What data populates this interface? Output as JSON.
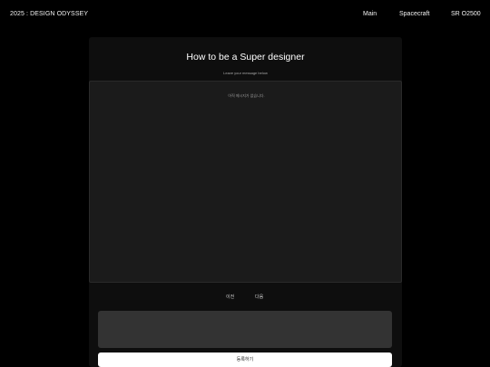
{
  "header": {
    "brand": "2025 : DESIGN ODYSSEY",
    "nav": {
      "main": "Main",
      "spacecraft": "Spacecraft",
      "sr": "SR O2500"
    }
  },
  "guestbook": {
    "title": "How to be a Super designer",
    "subtitle": "Leave your message below",
    "empty_message": "아직 메시지가 없습니다.",
    "prev_label": "이전",
    "next_label": "다음",
    "input_value": "",
    "input_placeholder": "",
    "submit_label": "등록하기"
  },
  "colors": {
    "background": "#000000",
    "panel": "#0e0e0e",
    "message_area": "#1b1b1b",
    "input": "#333333",
    "button": "#ffffff"
  }
}
